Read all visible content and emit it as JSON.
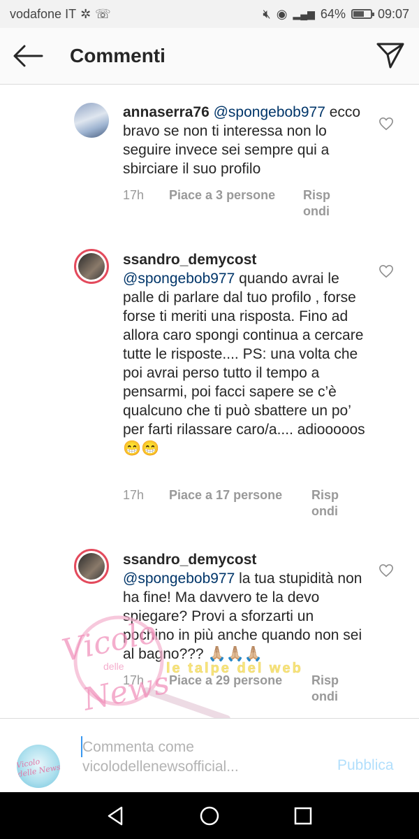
{
  "status_bar": {
    "carrier": "vodafone IT",
    "battery": "64%",
    "battery_level": 0.64,
    "time": "09:07"
  },
  "header": {
    "title": "Commenti",
    "back_icon": "arrow-left-icon",
    "send_icon": "paper-plane-icon"
  },
  "comments": [
    {
      "username": "annaserra76",
      "mention": "@spongebob977",
      "text": "ecco bravo se non ti interessa non lo seguire invece sei sempre qui a sbirciare il suo profilo",
      "time": "17h",
      "likes": "Piace a 3 persone",
      "reply": "Rispondi"
    },
    {
      "username": "ssandro_demycost",
      "mention": "@spongebob977",
      "text": "quando avrai le palle di parlare dal tuo profilo , forse forse ti meriti una risposta. Fino ad allora caro spongi continua a cercare tutte le risposte.... PS: una volta che poi avrai perso tutto il tempo a pensarmi, poi facci sapere se c’è qualcuno che ti può sbattere un po’ per farti rilassare caro/a.... adiooooos 😁😁",
      "time": "17h",
      "likes": "Piace a 17 persone",
      "reply": "Rispondi"
    },
    {
      "username": "ssandro_demycost",
      "mention": "@spongebob977",
      "text": "la tua stupidità non ha fine! Ma davvero te la devo spiegare? Provi a sforzarti un pochino in più anche quando non sei al bagno??? 🙏🏼🙏🏼🙏🏼",
      "time": "17h",
      "likes": "Piace a 29 persone",
      "reply": "Rispondi"
    }
  ],
  "watermark": {
    "line1": "Vicolo",
    "line2": "delle",
    "line3": "News",
    "tagline": "le talpe del web"
  },
  "input_bar": {
    "placeholder": "Commenta come vicolodellenewsofficial...",
    "post_label": "Pubblica",
    "avatar_text": "Vicolo delle News"
  },
  "colors": {
    "mention": "#003569",
    "post_disabled": "#b2dffc",
    "cursor": "#3897f0"
  }
}
